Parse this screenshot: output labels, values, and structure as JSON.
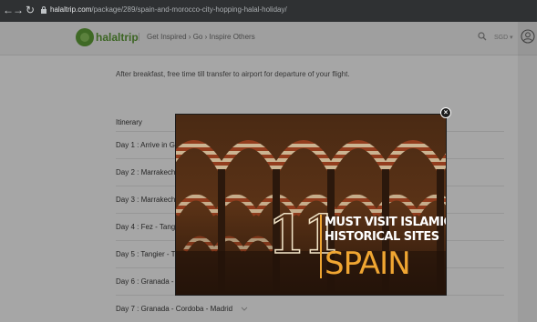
{
  "browser": {
    "back_icon": "arrow-left-icon",
    "forward_icon": "arrow-right-icon",
    "reload_icon": "reload-icon",
    "url_host": "halaltrip.com",
    "url_path": "/package/289/spain-and-morocco-city-hopping-halal-holiday/"
  },
  "header": {
    "logo_text": "halaltrip",
    "tagline": "Get Inspired › Go › Inspire Others",
    "currency": "SGD ▾",
    "brand_color": "#5c9b36"
  },
  "main": {
    "description": "After breakfast, free time till transfer to airport for departure of your flight.",
    "itinerary_heading": "Itinerary",
    "days": [
      {
        "label": "Day 1 : Arrive in G"
      },
      {
        "label": "Day 2 : Marrakech"
      },
      {
        "label": "Day 3 : Marrakech"
      },
      {
        "label": "Day 4 : Fez - Tang"
      },
      {
        "label": "Day 5 : Tangier - T"
      },
      {
        "label": "Day 6 : Granada -"
      },
      {
        "label": "Day 7 : Granada - Cordoba - Madrid"
      }
    ]
  },
  "modal": {
    "close_label": "×",
    "promo_number": "11",
    "promo_line1": "MUST VISIT ISLAMIC",
    "promo_line2": "HISTORICAL SITES",
    "promo_line3": "SPAIN",
    "accent_color": "#f0a632"
  }
}
